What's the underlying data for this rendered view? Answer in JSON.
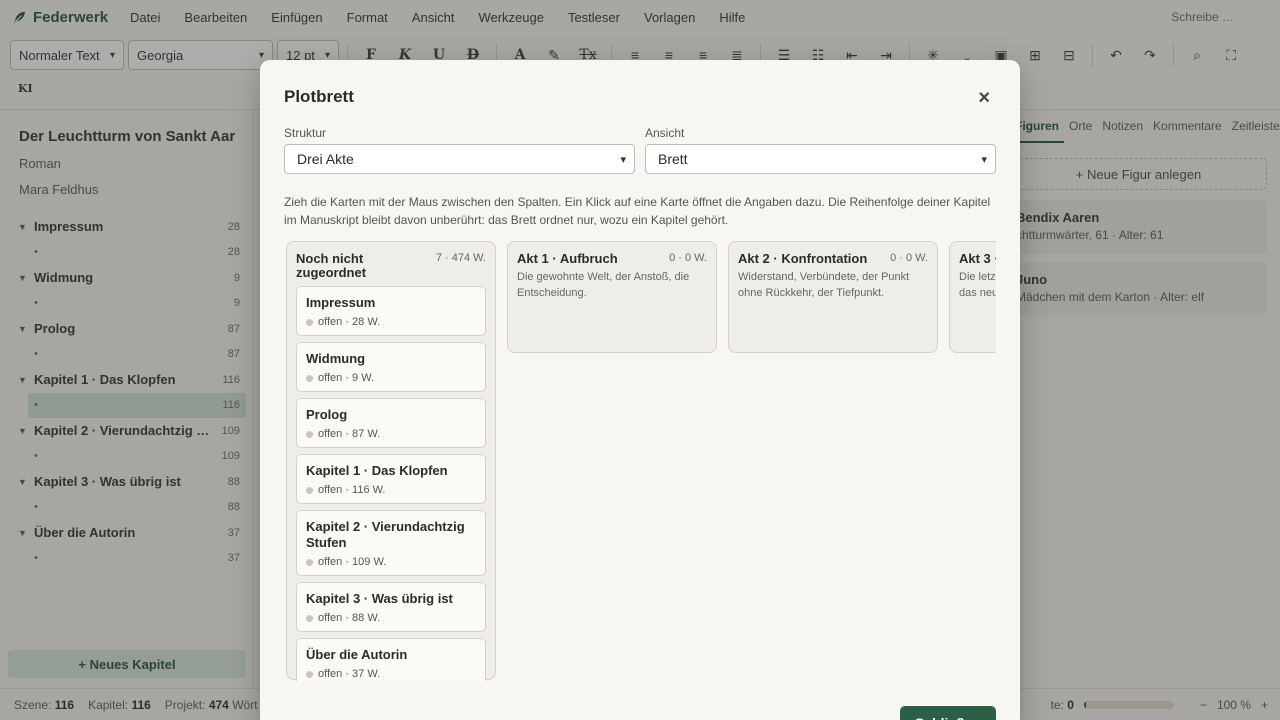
{
  "app": {
    "name": "Federwerk",
    "save_status": "Schreibe …"
  },
  "menu": [
    "Datei",
    "Bearbeiten",
    "Einfügen",
    "Format",
    "Ansicht",
    "Werkzeuge",
    "Testleser",
    "Vorlagen",
    "Hilfe"
  ],
  "toolbar": {
    "style_value": "Normaler Text",
    "font_value": "Georgia",
    "size_value": "12 pt",
    "bold": "F",
    "italic": "K",
    "underline": "U",
    "strike": "D",
    "font_color": "A",
    "clear_format": "Tx",
    "ki_label": "KI"
  },
  "project": {
    "title": "Der Leuchtturm von Sankt Aar",
    "genre": "Roman",
    "author": "Mara Feldhus"
  },
  "chapters": [
    {
      "name": "Impressum",
      "count": "28",
      "scene": "•",
      "scene_count": "28"
    },
    {
      "name": "Widmung",
      "count": "9",
      "scene": "•",
      "scene_count": "9"
    },
    {
      "name": "Prolog",
      "count": "87",
      "scene": "•",
      "scene_count": "87"
    },
    {
      "name": "Kapitel 1 · Das Klopfen",
      "count": "116",
      "scene": "•",
      "scene_count": "116"
    },
    {
      "name": "Kapitel 2 · Vierundachtzig Stufen",
      "count": "109",
      "scene": "•",
      "scene_count": "109"
    },
    {
      "name": "Kapitel 3 · Was übrig ist",
      "count": "88",
      "scene": "•",
      "scene_count": "88"
    },
    {
      "name": "Über die Autorin",
      "count": "37",
      "scene": "•",
      "scene_count": "37"
    }
  ],
  "new_chapter_label": "+ Neues Kapitel",
  "right_panel": {
    "tabs": [
      "Figuren",
      "Orte",
      "Notizen",
      "Kommentare",
      "Zeitleiste"
    ],
    "new_figure": "+ Neue Figur anlegen",
    "figures": [
      {
        "name": "Bendix Aaren",
        "desc": "chtturmwärter, 61 · Alter: 61"
      },
      {
        "name": "Juno",
        "desc": "Mädchen mit dem Karton · Alter: elf"
      }
    ]
  },
  "statusbar": {
    "scene_label": "Szene:",
    "scene_value": "116",
    "chapter_label": "Kapitel:",
    "chapter_value": "116",
    "project_label": "Projekt:",
    "project_value": "474",
    "project_unit": "Wört",
    "goal_label": "te:",
    "goal_value": "0",
    "goal_progress": 0.02,
    "zoom_minus": "−",
    "zoom": "100 %",
    "zoom_plus": "+"
  },
  "modal": {
    "title": "Plotbrett",
    "close_icon": "×",
    "structure_label": "Struktur",
    "structure_value": "Drei Akte",
    "view_label": "Ansicht",
    "view_value": "Brett",
    "hint": "Zieh die Karten mit der Maus zwischen den Spalten. Ein Klick auf eine Karte öffnet die Angaben dazu. Die Reihenfolge deiner Kapitel im Manuskript bleibt davon unberührt: das Brett ordnet nur, wozu ein Kapitel gehört.",
    "columns": [
      {
        "title": "Noch nicht zugeordnet",
        "count": "7 · 474 W.",
        "desc": ""
      },
      {
        "title": "Akt 1 · Aufbruch",
        "count": "0 · 0 W.",
        "desc": "Die gewohnte Welt, der Anstoß, die Entscheidung."
      },
      {
        "title": "Akt 2 · Konfrontation",
        "count": "0 · 0 W.",
        "desc": "Widerstand, Verbündete, der Punkt ohne Rückkehr, der Tiefpunkt."
      },
      {
        "title": "Akt 3 ·",
        "count": "",
        "desc": "Die letz das neu"
      }
    ],
    "cards": [
      {
        "title": "Impressum",
        "meta": "offen · 28 W."
      },
      {
        "title": "Widmung",
        "meta": "offen · 9 W."
      },
      {
        "title": "Prolog",
        "meta": "offen · 87 W."
      },
      {
        "title": "Kapitel 1 · Das Klopfen",
        "meta": "offen · 116 W."
      },
      {
        "title": "Kapitel 2 · Vierundachtzig Stufen",
        "meta": "offen · 109 W."
      },
      {
        "title": "Kapitel 3 · Was übrig ist",
        "meta": "offen · 88 W."
      },
      {
        "title": "Über die Autorin",
        "meta": "offen · 37 W."
      }
    ],
    "close_button": "Schließen"
  }
}
